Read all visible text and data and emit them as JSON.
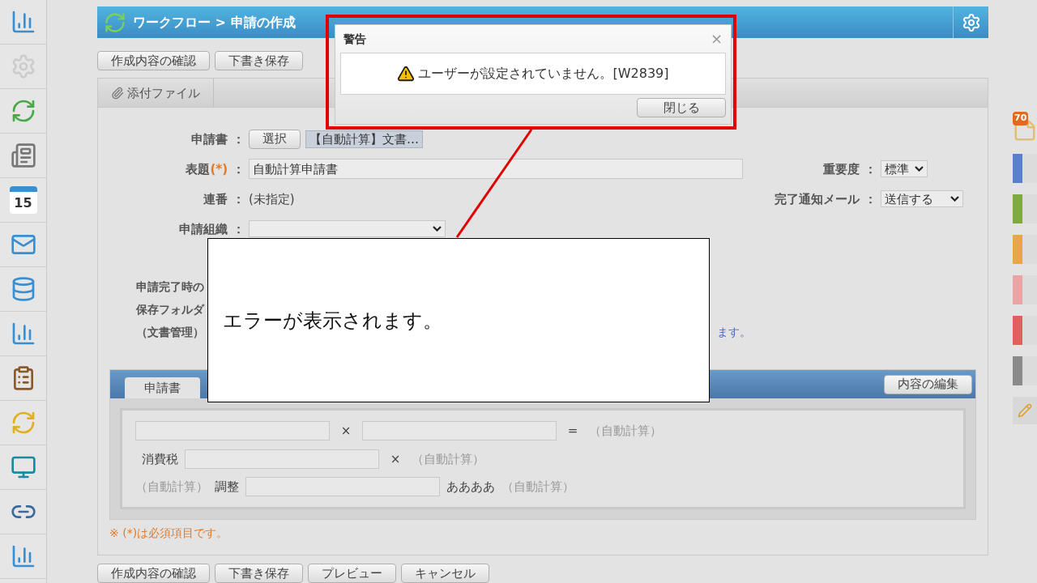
{
  "sidebar": {
    "calendar_day": "15"
  },
  "header": {
    "breadcrumb": "ワークフロー > 申請の作成"
  },
  "top_buttons": [
    "作成内容の確認",
    "下書き保存"
  ],
  "attachment_tab": "添付ファイル",
  "form": {
    "application": {
      "label": "申請書",
      "separator": "：",
      "select_button": "選択",
      "chip": "【自動計算】文書…"
    },
    "title": {
      "label": "表題",
      "required": "(*)",
      "separator": "：",
      "value": "自動計算申請書"
    },
    "number": {
      "label": "連番",
      "separator": "：",
      "value": "(未指定)"
    },
    "organization": {
      "label": "申請組織",
      "separator": "："
    },
    "importance": {
      "label": "重要度",
      "separator": "：",
      "value": "標準"
    },
    "mail": {
      "label": "完了通知メール",
      "separator": "：",
      "value": "送信する"
    }
  },
  "notes": [
    "申請完了時の",
    "保存フォルダ",
    "（文書管理）"
  ],
  "link_fragment": "ます。",
  "section": {
    "tabs": [
      {
        "label": "申請書",
        "selected": true
      }
    ],
    "edit_button": "内容の編集",
    "rows": [
      [
        {
          "kind": "field"
        },
        {
          "kind": "op",
          "text": "×"
        },
        {
          "kind": "field"
        },
        {
          "kind": "op",
          "text": "="
        },
        {
          "kind": "auto",
          "text": "（自動計算）"
        }
      ],
      [
        {
          "kind": "label",
          "text": "消費税"
        },
        {
          "kind": "field"
        },
        {
          "kind": "op",
          "text": "×"
        },
        {
          "kind": "auto",
          "text": "（自動計算）"
        }
      ],
      [
        {
          "kind": "auto",
          "text": "（自動計算）"
        },
        {
          "kind": "label",
          "text": "調整"
        },
        {
          "kind": "field"
        },
        {
          "kind": "label",
          "text": "ああああ"
        },
        {
          "kind": "auto",
          "text": "（自動計算）"
        }
      ]
    ]
  },
  "required_note": "※ (*)は必須項目です。",
  "bottom_buttons": [
    "作成内容の確認",
    "下書き保存",
    "プレビュー",
    "キャンセル"
  ],
  "dialog": {
    "title": "警告",
    "close": "×",
    "message": "ユーザーが設定されていません。[W2839]",
    "button": "閉じる"
  },
  "callout": {
    "text": "エラーが表示されます。"
  },
  "right_rail": {
    "badge": "70",
    "tabs": [
      {
        "color": "#5b7fcf"
      },
      {
        "color": "#7faa3f"
      },
      {
        "color": "#e8a64b"
      },
      {
        "color": "#eba3a3"
      },
      {
        "color": "#e06060"
      },
      {
        "color": "#8a8a8a"
      }
    ]
  }
}
